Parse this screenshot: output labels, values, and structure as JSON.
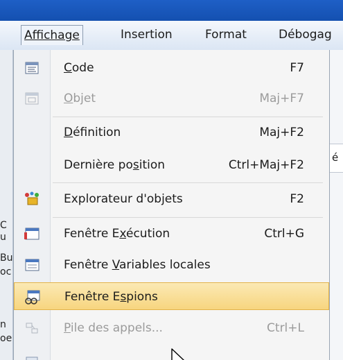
{
  "menubar": {
    "affichage": "Affichage",
    "insertion": "Insertion",
    "format": "Format",
    "debogage": "Débogag"
  },
  "menu_items": [
    {
      "pre": "",
      "u": "C",
      "post": "ode",
      "accel": "F7",
      "icon": "code-icon"
    },
    {
      "pre": "",
      "u": "O",
      "post": "bjet",
      "accel": "Maj+F7",
      "icon": "object-icon"
    },
    {
      "pre": "",
      "u": "D",
      "post": "éfinition",
      "accel": "Maj+F2",
      "icon": ""
    },
    {
      "pre": "Dernière po",
      "u": "s",
      "post": "ition",
      "accel": "Ctrl+Maj+F2",
      "icon": ""
    },
    {
      "pre": "Explorateur d'objets",
      "u": "",
      "post": "",
      "accel": "F2",
      "icon": "object-browser-icon"
    },
    {
      "pre": "Fenêtre E",
      "u": "x",
      "post": "écution",
      "accel": "Ctrl+G",
      "icon": "immediate-window-icon"
    },
    {
      "pre": "Fenêtre ",
      "u": "V",
      "post": "ariables locales",
      "accel": "",
      "icon": "locals-window-icon"
    },
    {
      "pre": "Fenêtre E",
      "u": "s",
      "post": "pions",
      "accel": "",
      "icon": "watch-window-icon"
    },
    {
      "pre": "",
      "u": "P",
      "post": "ile des appels...",
      "accel": "Ctrl+L",
      "icon": "call-stack-icon"
    }
  ],
  "background_stubs": {
    "right_char": "é",
    "left_letters": [
      "C",
      "u",
      "Bu",
      "oc",
      "n",
      "oe"
    ]
  }
}
